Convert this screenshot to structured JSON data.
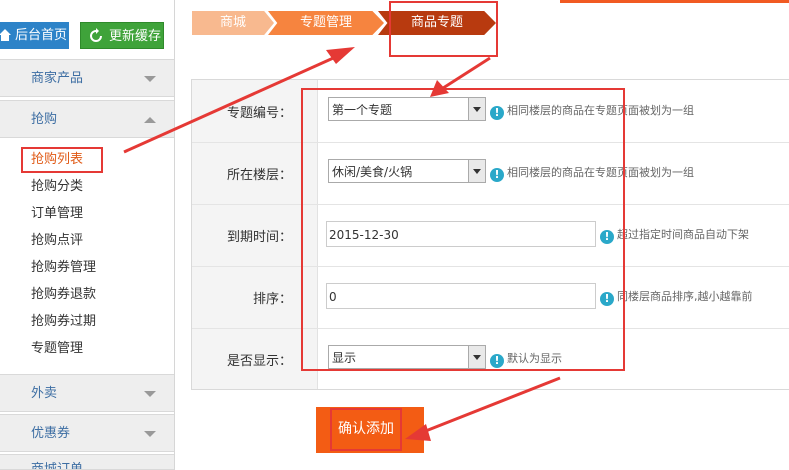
{
  "sidebar": {
    "home_button": "后台首页",
    "refresh_button": "更新缓存",
    "sections": [
      {
        "label": "商家产品"
      },
      {
        "label": "抢购"
      },
      {
        "label": "外卖"
      },
      {
        "label": "优惠券"
      },
      {
        "label": "商城订单"
      }
    ],
    "subitems": [
      "抢购列表",
      "抢购分类",
      "订单管理",
      "抢购点评",
      "抢购券管理",
      "抢购券退款",
      "抢购券过期",
      "专题管理"
    ]
  },
  "breadcrumb": [
    "商城",
    "专题管理",
    "商品专题"
  ],
  "form": {
    "fields": [
      {
        "label": "专题编号：",
        "value": "第一个专题",
        "tip": "相同楼层的商品在专题页面被划为一组"
      },
      {
        "label": "所在楼层：",
        "value": "休闲/美食/火锅",
        "tip": "相同楼层的商品在专题页面被划为一组"
      },
      {
        "label": "到期时间：",
        "value": "2015-12-30",
        "tip": "超过指定时间商品自动下架"
      },
      {
        "label": "排序：",
        "value": "0",
        "tip": "同楼层商品排序,越小越靠前"
      },
      {
        "label": "是否显示：",
        "value": "显示",
        "tip": "默认为显示"
      }
    ],
    "submit_label": "确认添加",
    "tip_icon": "!"
  },
  "colors": {
    "accent": "#f35c14",
    "highlight": "#e53935",
    "sidebar_link": "#3d6ea3"
  }
}
